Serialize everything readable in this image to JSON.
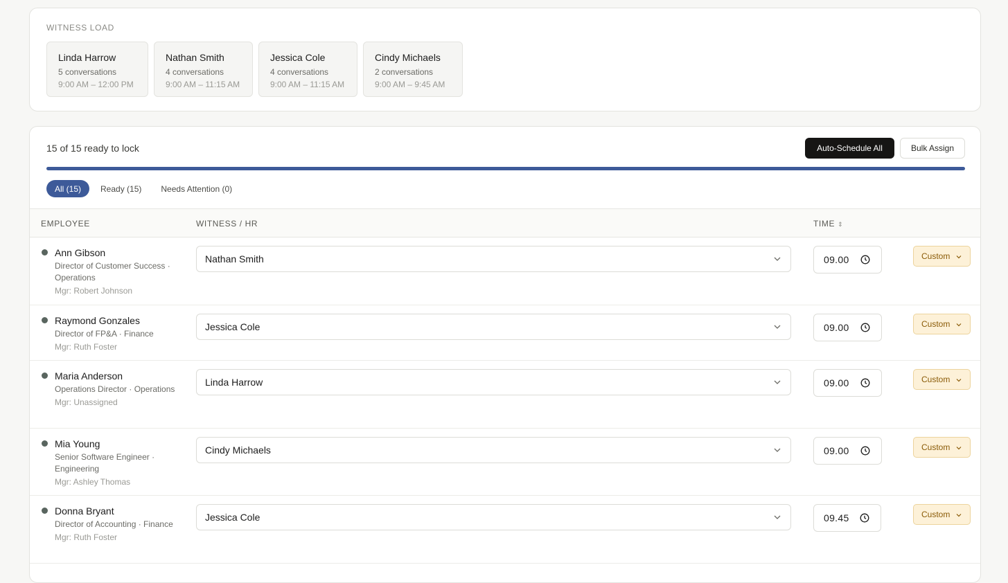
{
  "witness_load": {
    "title": "WITNESS LOAD",
    "witnesses": [
      {
        "name": "Linda Harrow",
        "conversations": "5 conversations",
        "time": "9:00 AM – 12:00 PM"
      },
      {
        "name": "Nathan Smith",
        "conversations": "4 conversations",
        "time": "9:00 AM – 11:15 AM"
      },
      {
        "name": "Jessica Cole",
        "conversations": "4 conversations",
        "time": "9:00 AM – 11:15 AM"
      },
      {
        "name": "Cindy Michaels",
        "conversations": "2 conversations",
        "time": "9:00 AM – 9:45 AM"
      }
    ]
  },
  "status": {
    "ready_text": "15 of 15 ready to lock",
    "progress_fraction": 1.0
  },
  "actions": {
    "auto_schedule": "Auto-Schedule All",
    "bulk_assign": "Bulk Assign"
  },
  "filters": [
    {
      "label": "All (15)",
      "active": true
    },
    {
      "label": "Ready (15)",
      "active": false
    },
    {
      "label": "Needs Attention (0)",
      "active": false
    }
  ],
  "table": {
    "headers": {
      "employee": "EMPLOYEE",
      "witness": "WITNESS / HR",
      "time": "TIME"
    },
    "rows": [
      {
        "name": "Ann Gibson",
        "role": "Director of Customer Success · Operations",
        "manager": "Mgr: Robert Johnson",
        "witness": "Nathan Smith",
        "time": "09.00",
        "badge": "Custom"
      },
      {
        "name": "Raymond Gonzales",
        "role": "Director of FP&A · Finance",
        "manager": "Mgr: Ruth Foster",
        "witness": "Jessica Cole",
        "time": "09.00",
        "badge": "Custom"
      },
      {
        "name": "Maria Anderson",
        "role": "Operations Director · Operations",
        "manager": "Mgr: Unassigned",
        "witness": "Linda Harrow",
        "time": "09.00",
        "badge": "Custom"
      },
      {
        "name": "Mia Young",
        "role": "Senior Software Engineer · Engineering",
        "manager": "Mgr: Ashley Thomas",
        "witness": "Cindy Michaels",
        "time": "09.00",
        "badge": "Custom"
      },
      {
        "name": "Donna Bryant",
        "role": "Director of Accounting · Finance",
        "manager": "Mgr: Ruth Foster",
        "witness": "Jessica Cole",
        "time": "09.45",
        "badge": "Custom"
      }
    ]
  },
  "colors": {
    "accent": "#3d5a99",
    "badge_bg": "#fdf1d8",
    "badge_text": "#8a5a06",
    "status_dot": "#59655f"
  }
}
